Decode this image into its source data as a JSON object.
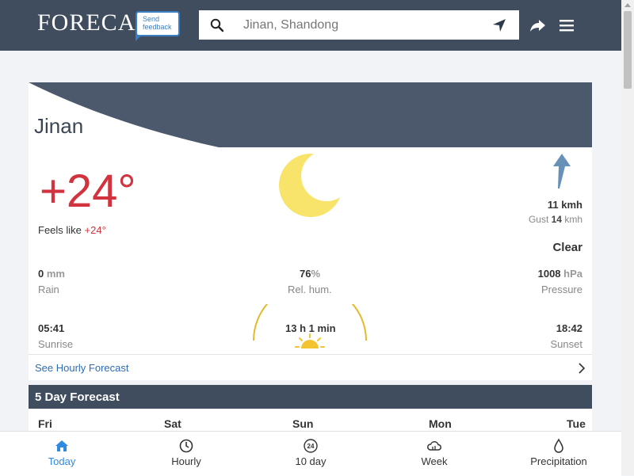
{
  "header": {
    "logo": "FORECA",
    "feedback_label": "Send feedback",
    "search_value": "Jinan, Shandong"
  },
  "location": {
    "city": "Jinan"
  },
  "current": {
    "temperature": "+24°",
    "feels_like_label": "Feels like",
    "feels_like_value": "+24°",
    "wind_speed": "11 kmh",
    "gust_label": "Gust",
    "gust_value": "14",
    "gust_unit": "kmh",
    "condition": "Clear",
    "rain_value": "0",
    "rain_unit": "mm",
    "rain_label": "Rain",
    "humidity_value": "76",
    "humidity_unit": "%",
    "humidity_label": "Rel. hum.",
    "pressure_value": "1008",
    "pressure_unit": "hPa",
    "pressure_label": "Pressure"
  },
  "sun": {
    "sunrise": "05:41",
    "sunrise_label": "Sunrise",
    "day_length": "13 h 1 min",
    "sunset": "18:42",
    "sunset_label": "Sunset"
  },
  "hourly_link": "See Hourly Forecast",
  "forecast": {
    "title": "5 Day Forecast",
    "days": [
      "Fri",
      "Sat",
      "Sun",
      "Mon",
      "Tue"
    ]
  },
  "bottom_nav": [
    {
      "label": "Today",
      "icon": "home-icon",
      "active": true
    },
    {
      "label": "Hourly",
      "icon": "clock-icon",
      "active": false
    },
    {
      "label": "10 day",
      "icon": "calendar-24-icon",
      "active": false
    },
    {
      "label": "Week",
      "icon": "cloud-sun-icon",
      "active": false
    },
    {
      "label": "Precipitation",
      "icon": "droplet-icon",
      "active": false
    }
  ],
  "colors": {
    "header_bg": "#3f4d5f",
    "temperature": "#d1343f",
    "link": "#2f6db3",
    "active_nav": "#2f8ae0",
    "moon": "#f8e46a",
    "sun_arc": "#e6b92a"
  }
}
